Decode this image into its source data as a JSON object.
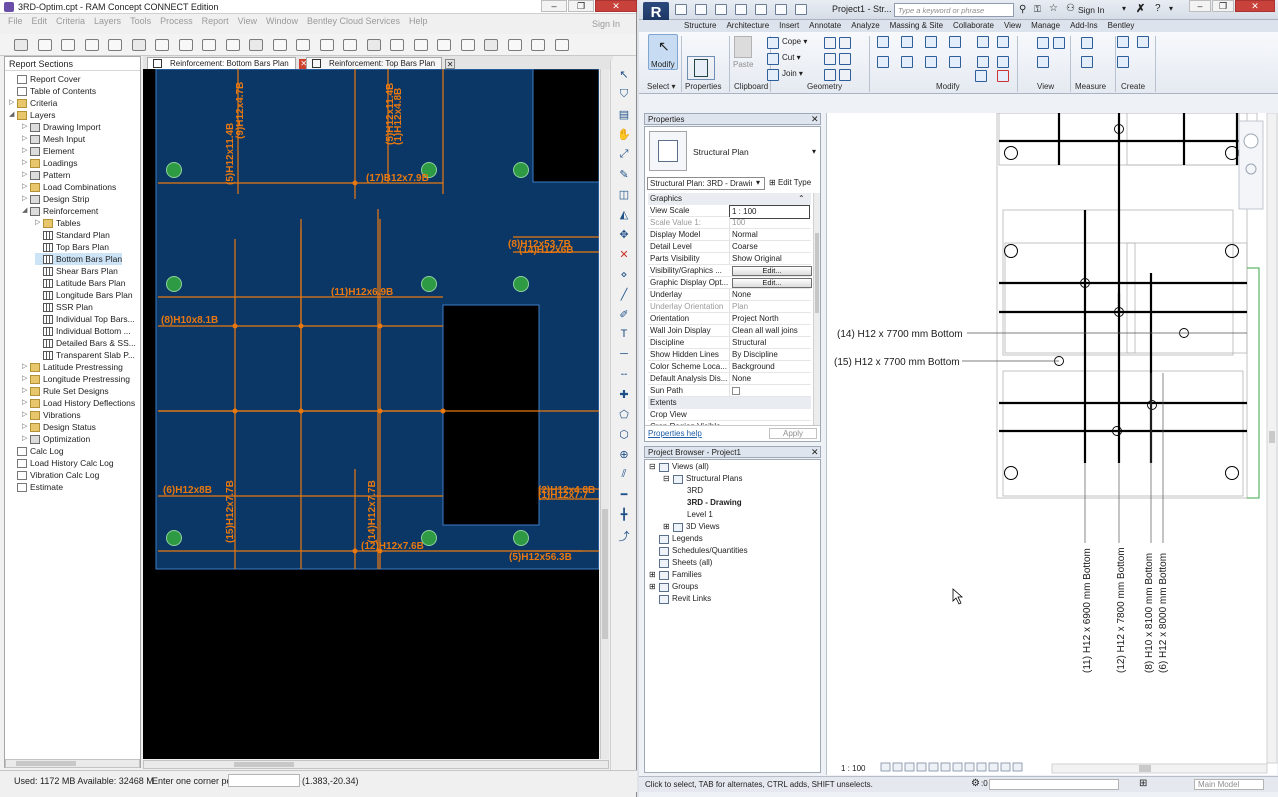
{
  "left_app": {
    "title": "3RD-Optim.cpt - RAM Concept CONNECT Edition",
    "menu": [
      "File",
      "Edit",
      "Criteria",
      "Layers",
      "Tools",
      "Process",
      "Report",
      "View",
      "Window",
      "Bentley Cloud Services",
      "Help"
    ],
    "sign_in": "Sign In",
    "report_sections_label": "Report Sections",
    "tree": [
      {
        "label": "Report Cover",
        "depth": 0,
        "icon": "doc-icon"
      },
      {
        "label": "Table of Contents",
        "depth": 0,
        "icon": "doc-icon"
      },
      {
        "label": "Criteria",
        "depth": 0,
        "icon": "folder-icon",
        "arrow": "▷"
      },
      {
        "label": "Layers",
        "depth": 0,
        "icon": "folder-icon",
        "arrow": "◢"
      },
      {
        "label": "Drawing Import",
        "depth": 1,
        "icon": "layer-icon",
        "arrow": "▷"
      },
      {
        "label": "Mesh Input",
        "depth": 1,
        "icon": "layer-icon",
        "arrow": "▷"
      },
      {
        "label": "Element",
        "depth": 1,
        "icon": "layer-icon",
        "arrow": "▷"
      },
      {
        "label": "Loadings",
        "depth": 1,
        "icon": "folder-icon",
        "arrow": "▷"
      },
      {
        "label": "Pattern",
        "depth": 1,
        "icon": "layer-icon",
        "arrow": "▷"
      },
      {
        "label": "Load Combinations",
        "depth": 1,
        "icon": "folder-icon",
        "arrow": "▷"
      },
      {
        "label": "Design Strip",
        "depth": 1,
        "icon": "layer-icon",
        "arrow": "▷"
      },
      {
        "label": "Reinforcement",
        "depth": 1,
        "icon": "layer-icon",
        "arrow": "◢"
      },
      {
        "label": "Tables",
        "depth": 2,
        "icon": "folder-icon",
        "arrow": "▷"
      },
      {
        "label": "Standard Plan",
        "depth": 2,
        "icon": "grid-icon"
      },
      {
        "label": "Top Bars Plan",
        "depth": 2,
        "icon": "grid-icon"
      },
      {
        "label": "Bottom Bars Plan",
        "depth": 2,
        "icon": "grid-icon",
        "selected": true
      },
      {
        "label": "Shear Bars Plan",
        "depth": 2,
        "icon": "grid-icon"
      },
      {
        "label": "Latitude Bars Plan",
        "depth": 2,
        "icon": "grid-icon"
      },
      {
        "label": "Longitude Bars Plan",
        "depth": 2,
        "icon": "grid-icon"
      },
      {
        "label": "SSR Plan",
        "depth": 2,
        "icon": "grid-icon"
      },
      {
        "label": "Individual Top Bars...",
        "depth": 2,
        "icon": "grid-icon"
      },
      {
        "label": "Individual Bottom ...",
        "depth": 2,
        "icon": "grid-icon"
      },
      {
        "label": "Detailed Bars & SS...",
        "depth": 2,
        "icon": "grid-icon"
      },
      {
        "label": "Transparent Slab P...",
        "depth": 2,
        "icon": "grid-icon"
      },
      {
        "label": "Latitude Prestressing",
        "depth": 1,
        "icon": "folder-icon",
        "arrow": "▷"
      },
      {
        "label": "Longitude Prestressing",
        "depth": 1,
        "icon": "folder-icon",
        "arrow": "▷"
      },
      {
        "label": "Rule Set Designs",
        "depth": 1,
        "icon": "folder-icon",
        "arrow": "▷"
      },
      {
        "label": "Load History Deflections",
        "depth": 1,
        "icon": "folder-icon",
        "arrow": "▷"
      },
      {
        "label": "Vibrations",
        "depth": 1,
        "icon": "folder-icon",
        "arrow": "▷"
      },
      {
        "label": "Design Status",
        "depth": 1,
        "icon": "folder-icon",
        "arrow": "▷"
      },
      {
        "label": "Optimization",
        "depth": 1,
        "icon": "layer-icon",
        "arrow": "▷"
      },
      {
        "label": "Calc Log",
        "depth": 0,
        "icon": "doc-icon"
      },
      {
        "label": "Load History Calc Log",
        "depth": 0,
        "icon": "doc-icon"
      },
      {
        "label": "Vibration Calc Log",
        "depth": 0,
        "icon": "doc-icon"
      },
      {
        "label": "Estimate",
        "depth": 0,
        "icon": "doc-icon"
      }
    ],
    "tabs": [
      "Reinforcement: Bottom Bars Plan",
      "Reinforcement: Top Bars Plan"
    ],
    "status": {
      "memory": "Used: 1172 MB  Available: 32468 M",
      "prompt": "Enter one corner point:",
      "coords": "(1.383,-20.34)"
    },
    "bar_labels": [
      "(5)H12x11.4B",
      "(9)H12x4.7B",
      "(5)H12x11.4B",
      "(1)H12x4.8B",
      "(17)B12x7.9B",
      "(8)H12x53.7B",
      "(14)H12x6B",
      "(11)H12x6.9B",
      "(8)H10x8.1B",
      "(6)H12x8B",
      "(15)H12x7.7B",
      "(14)H12x7.7B",
      "(12)H12x7.6B",
      "(2)H12x4.8B",
      "(1)H12x7.7",
      "(5)H12x56.3B"
    ]
  },
  "right_app": {
    "title": "Project1 - Str...",
    "search_placeholder": "Type a keyword or phrase",
    "sign_in": "Sign In",
    "ribbon_tabs": [
      "Structure",
      "Architecture",
      "Insert",
      "Annotate",
      "Analyze",
      "Massing & Site",
      "Collaborate",
      "View",
      "Manage",
      "Add-Ins",
      "Bentley"
    ],
    "ribbon_panels": [
      "Select ▾",
      "Properties",
      "Clipboard",
      "Geometry",
      "Modify",
      "View",
      "Measure",
      "Create"
    ],
    "ribbon_buttons": {
      "modify": "Modify",
      "properties": "Properties",
      "paste": "Paste",
      "cope": "Cope",
      "cut": "Cut",
      "join": "Join"
    },
    "properties": {
      "title": "Properties",
      "type_name": "Structural Plan",
      "instance": "Structural Plan: 3RD - Drawing",
      "edit_type": "Edit Type",
      "graphics_header": "Graphics",
      "rows": [
        {
          "k": "View Scale",
          "v": "1 : 100"
        },
        {
          "k": "Scale Value    1:",
          "v": "100",
          "dim": true
        },
        {
          "k": "Display Model",
          "v": "Normal"
        },
        {
          "k": "Detail Level",
          "v": "Coarse"
        },
        {
          "k": "Parts Visibility",
          "v": "Show Original"
        },
        {
          "k": "Visibility/Graphics ...",
          "v": "Edit...",
          "btn": true
        },
        {
          "k": "Graphic Display Opt...",
          "v": "Edit...",
          "btn": true
        },
        {
          "k": "Underlay",
          "v": "None"
        },
        {
          "k": "Underlay Orientation",
          "v": "Plan",
          "dim": true
        },
        {
          "k": "Orientation",
          "v": "Project North"
        },
        {
          "k": "Wall Join Display",
          "v": "Clean all wall joins"
        },
        {
          "k": "Discipline",
          "v": "Structural"
        },
        {
          "k": "Show Hidden Lines",
          "v": "By Discipline"
        },
        {
          "k": "Color Scheme Loca...",
          "v": "Background"
        },
        {
          "k": "Default Analysis Dis...",
          "v": "None"
        },
        {
          "k": "Sun Path",
          "v": ""
        }
      ],
      "extents_header": "Extents",
      "crop_view": "Crop View",
      "crop_region": "Crop Region Visible",
      "help": "Properties help",
      "apply": "Apply"
    },
    "project_browser": {
      "title": "Project Browser - Project1",
      "items": [
        {
          "label": "Views (all)",
          "depth": 0,
          "arrow": "⊟"
        },
        {
          "label": "Structural Plans",
          "depth": 1,
          "arrow": "⊟"
        },
        {
          "label": "3RD",
          "depth": 2
        },
        {
          "label": "3RD - Drawing",
          "depth": 2,
          "bold": true
        },
        {
          "label": "Level 1",
          "depth": 2
        },
        {
          "label": "3D Views",
          "depth": 1,
          "arrow": "⊞"
        },
        {
          "label": "Legends",
          "depth": 0
        },
        {
          "label": "Schedules/Quantities",
          "depth": 0
        },
        {
          "label": "Sheets (all)",
          "depth": 0
        },
        {
          "label": "Families",
          "depth": 0,
          "arrow": "⊞"
        },
        {
          "label": "Groups",
          "depth": 0,
          "arrow": "⊞"
        },
        {
          "label": "Revit Links",
          "depth": 0
        }
      ]
    },
    "view_annotations": {
      "h14": "(14) H12 x 7700 mm Bottom",
      "h15": "(15) H12 x 7700 mm Bottom",
      "v11": "(11) H12 x 6900 mm Bottom",
      "v12": "(12) H12 x 7800 mm Bottom",
      "v8": "(8) H10 x 8100 mm Bottom",
      "v6": "(6) H12 x 8000 mm Bottom"
    },
    "view_scale": "1 : 100",
    "status_text": "Click to select, TAB for alternates, CTRL adds, SHIFT unselects.",
    "model": "Main Model"
  },
  "colors": {
    "slab": "#0a3766",
    "rebar": "#e8780f",
    "column": "#2e9a43"
  }
}
